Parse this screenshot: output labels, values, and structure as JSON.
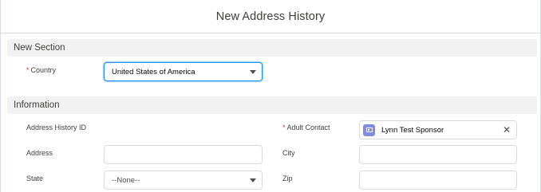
{
  "modal": {
    "title": "New Address History"
  },
  "sections": {
    "new_section": "New Section",
    "information": "Information"
  },
  "fields": {
    "country": {
      "label": "Country",
      "required_mark": "*",
      "value": "United States of America"
    },
    "address_history_id": {
      "label": "Address History ID"
    },
    "adult_contact": {
      "label": "Adult Contact",
      "required_mark": "*",
      "value": "Lynn Test Sponsor",
      "icon": "contact-card-icon",
      "clear_icon": "close-icon"
    },
    "address": {
      "label": "Address",
      "value": ""
    },
    "city": {
      "label": "City",
      "value": ""
    },
    "state": {
      "label": "State",
      "value": "--None--"
    },
    "zip": {
      "label": "Zip",
      "value": ""
    }
  },
  "colors": {
    "accent": "#1b96ff",
    "required": "#c23934",
    "lookup_icon_bg": "#7f8de1",
    "section_bg": "#f3f2f2"
  }
}
